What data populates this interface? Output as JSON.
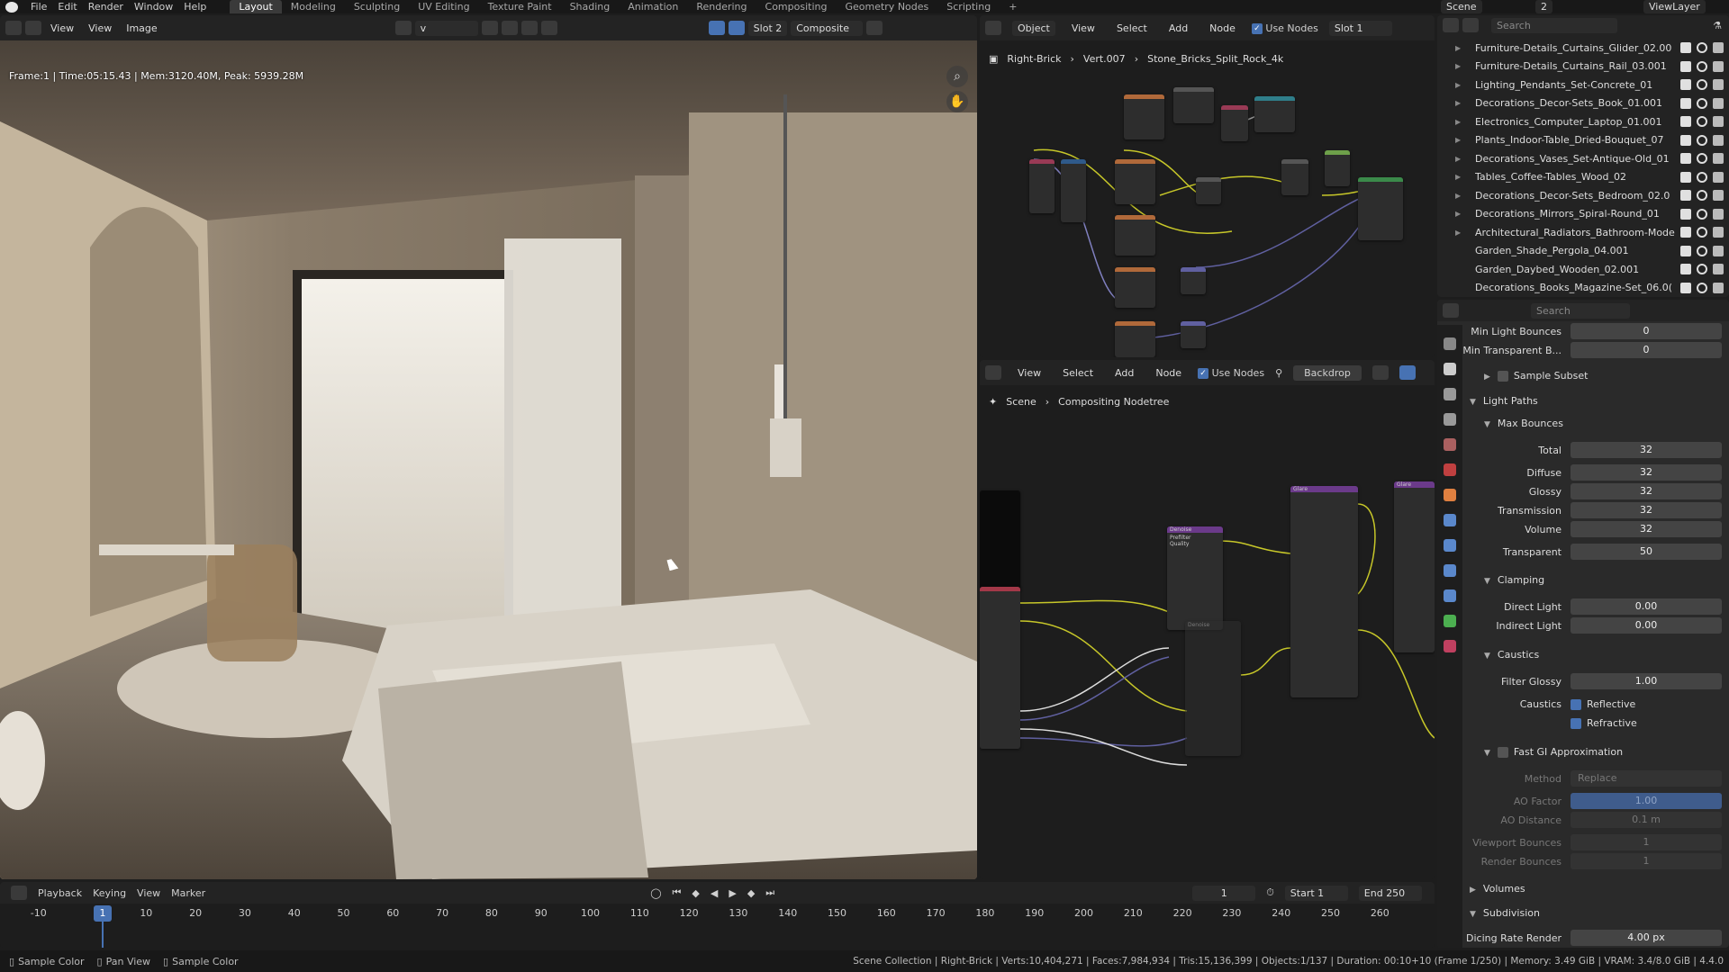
{
  "topbar": {
    "menus": [
      "File",
      "Edit",
      "Render",
      "Window",
      "Help"
    ],
    "workspaces": [
      "Layout",
      "Modeling",
      "Sculpting",
      "UV Editing",
      "Texture Paint",
      "Shading",
      "Animation",
      "Rendering",
      "Compositing",
      "Geometry Nodes",
      "Scripting"
    ],
    "active_workspace": "Layout",
    "add_tab": "+",
    "scene": "Scene",
    "scene_count": "2",
    "view_layer": "ViewLayer"
  },
  "image_editor": {
    "view": "View",
    "view2": "View",
    "image_menu": "Image",
    "image_name": "v",
    "slot": "Slot 2",
    "pass": "Composite",
    "render_info": "Frame:1 | Time:05:15.43 | Mem:3120.40M, Peak: 5939.28M"
  },
  "shader_editor": {
    "mode": "Object",
    "menus": [
      "View",
      "Select",
      "Add",
      "Node"
    ],
    "use_nodes": "Use Nodes",
    "slot": "Slot 1",
    "breadcrumb": [
      "Right-Brick",
      "Vert.007",
      "Stone_Bricks_Split_Rock_4k"
    ]
  },
  "compositor": {
    "menus": [
      "View",
      "Select",
      "Add",
      "Node"
    ],
    "use_nodes": "Use Nodes",
    "backdrop": "Backdrop",
    "breadcrumb": [
      "Scene",
      "Compositing Nodetree"
    ],
    "nodes": {
      "denoise1": "Denoise",
      "denoise2": "Denoise",
      "glare1": "Glare",
      "glare2": "Glare",
      "prefilter": "Prefilter",
      "quality": "Quality"
    }
  },
  "outliner": {
    "search_placeholder": "Search",
    "items": [
      {
        "name": "Furniture-Details_Curtains_Glider_02.00",
        "expandable": true
      },
      {
        "name": "Furniture-Details_Curtains_Rail_03.001",
        "expandable": true
      },
      {
        "name": "Lighting_Pendants_Set-Concrete_01",
        "expandable": true
      },
      {
        "name": "Decorations_Decor-Sets_Book_01.001",
        "expandable": true
      },
      {
        "name": "Electronics_Computer_Laptop_01.001",
        "expandable": true
      },
      {
        "name": "Plants_Indoor-Table_Dried-Bouquet_07",
        "expandable": true
      },
      {
        "name": "Decorations_Vases_Set-Antique-Old_01",
        "expandable": true
      },
      {
        "name": "Tables_Coffee-Tables_Wood_02",
        "expandable": true
      },
      {
        "name": "Decorations_Decor-Sets_Bedroom_02.0",
        "expandable": true
      },
      {
        "name": "Decorations_Mirrors_Spiral-Round_01",
        "expandable": true
      },
      {
        "name": "Architectural_Radiators_Bathroom-Mode",
        "expandable": true
      },
      {
        "name": "Garden_Shade_Pergola_04.001",
        "expandable": false
      },
      {
        "name": "Garden_Daybed_Wooden_02.001",
        "expandable": false
      },
      {
        "name": "Decorations_Books_Magazine-Set_06.0(",
        "expandable": false
      }
    ]
  },
  "properties": {
    "search_placeholder": "Search",
    "min_light_bounces": {
      "label": "Min Light Bounces",
      "value": "0"
    },
    "min_transparent": {
      "label": "Min Transparent B...",
      "value": "0"
    },
    "sample_subset": "Sample Subset",
    "light_paths": "Light Paths",
    "max_bounces": "Max Bounces",
    "bounces": [
      {
        "label": "Total",
        "value": "32"
      },
      {
        "label": "Diffuse",
        "value": "32"
      },
      {
        "label": "Glossy",
        "value": "32"
      },
      {
        "label": "Transmission",
        "value": "32"
      },
      {
        "label": "Volume",
        "value": "32"
      },
      {
        "label": "Transparent",
        "value": "50"
      }
    ],
    "clamping": "Clamping",
    "direct_light": {
      "label": "Direct Light",
      "value": "0.00"
    },
    "indirect_light": {
      "label": "Indirect Light",
      "value": "0.00"
    },
    "caustics": "Caustics",
    "filter_glossy": {
      "label": "Filter Glossy",
      "value": "1.00"
    },
    "caustics_label": "Caustics",
    "reflective": "Reflective",
    "refractive": "Refractive",
    "fast_gi": "Fast GI Approximation",
    "method": {
      "label": "Method",
      "value": "Replace"
    },
    "ao_factor": {
      "label": "AO Factor",
      "value": "1.00"
    },
    "ao_distance": {
      "label": "AO Distance",
      "value": "0.1 m"
    },
    "viewport_bounces": {
      "label": "Viewport Bounces",
      "value": "1"
    },
    "render_bounces": {
      "label": "Render Bounces",
      "value": "1"
    },
    "volumes": "Volumes",
    "subdivision": "Subdivision",
    "dicing_rate": {
      "label": "Dicing Rate Render",
      "value": "4.00 px"
    }
  },
  "timeline": {
    "menus": [
      "Playback",
      "Keying",
      "View",
      "Marker"
    ],
    "current_frame": "1",
    "start_label": "Start",
    "start": "1",
    "end_label": "End",
    "end": "250",
    "playhead": "1",
    "ticks": [
      "-10",
      "10",
      "20",
      "30",
      "40",
      "50",
      "60",
      "70",
      "80",
      "90",
      "100",
      "110",
      "120",
      "130",
      "140",
      "150",
      "160",
      "170",
      "180",
      "190",
      "200",
      "210",
      "220",
      "230",
      "240",
      "250",
      "260"
    ]
  },
  "statusbar": {
    "left": [
      "Sample Color",
      "Pan View",
      "Sample Color"
    ],
    "right": "Scene Collection | Right-Brick | Verts:10,404,271 | Faces:7,984,934 | Tris:15,136,399 | Objects:1/137 | Duration: 00:10+10 (Frame 1/250) | Memory: 3.49 GiB | VRAM: 3.4/8.0 GiB | 4.4.0"
  },
  "colors": {
    "accent": "#4772b3",
    "panel": "#2a2a2a",
    "header": "#232323"
  }
}
